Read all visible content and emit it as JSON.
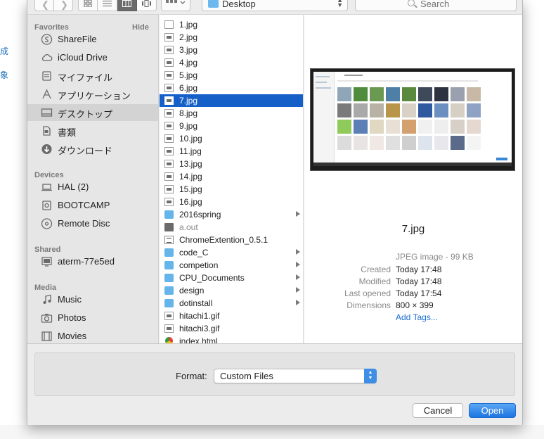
{
  "background": {
    "left_chars": [
      "成",
      "象"
    ]
  },
  "toolbar": {
    "location": "Desktop",
    "search_placeholder": "Search"
  },
  "sidebar": {
    "hide_label": "Hide",
    "sections": [
      {
        "title": "Favorites",
        "items": [
          {
            "label": "ShareFile",
            "icon": "sharefile-icon"
          },
          {
            "label": "iCloud Drive",
            "icon": "cloud-icon"
          },
          {
            "label": "マイファイル",
            "icon": "all-my-files-icon"
          },
          {
            "label": "アプリケーション",
            "icon": "applications-icon"
          },
          {
            "label": "デスクトップ",
            "icon": "desktop-icon",
            "selected": true
          },
          {
            "label": "書類",
            "icon": "documents-icon"
          },
          {
            "label": "ダウンロード",
            "icon": "downloads-icon"
          }
        ]
      },
      {
        "title": "Devices",
        "items": [
          {
            "label": "HAL (2)",
            "icon": "laptop-icon"
          },
          {
            "label": "BOOTCAMP",
            "icon": "drive-icon"
          },
          {
            "label": "Remote Disc",
            "icon": "disc-icon"
          }
        ]
      },
      {
        "title": "Shared",
        "items": [
          {
            "label": "aterm-77e5ed",
            "icon": "monitor-icon"
          }
        ]
      },
      {
        "title": "Media",
        "items": [
          {
            "label": "Music",
            "icon": "music-icon"
          },
          {
            "label": "Photos",
            "icon": "camera-icon"
          },
          {
            "label": "Movies",
            "icon": "film-icon"
          }
        ]
      }
    ]
  },
  "files": [
    {
      "name": "1.jpg",
      "kind": "img-blank"
    },
    {
      "name": "2.jpg",
      "kind": "img"
    },
    {
      "name": "3.jpg",
      "kind": "img"
    },
    {
      "name": "4.jpg",
      "kind": "img"
    },
    {
      "name": "5.jpg",
      "kind": "img"
    },
    {
      "name": "6.jpg",
      "kind": "img"
    },
    {
      "name": "7.jpg",
      "kind": "img",
      "selected": true
    },
    {
      "name": "8.jpg",
      "kind": "img"
    },
    {
      "name": "9.jpg",
      "kind": "img"
    },
    {
      "name": "10.jpg",
      "kind": "img"
    },
    {
      "name": "11.jpg",
      "kind": "img"
    },
    {
      "name": "13.jpg",
      "kind": "img"
    },
    {
      "name": "14.jpg",
      "kind": "img"
    },
    {
      "name": "15.jpg",
      "kind": "img"
    },
    {
      "name": "16.jpg",
      "kind": "img"
    },
    {
      "name": "2016spring",
      "kind": "folder",
      "arrow": true
    },
    {
      "name": "a.out",
      "kind": "exec",
      "dim": true
    },
    {
      "name": "ChromeExtention_0.5.1",
      "kind": "doc"
    },
    {
      "name": "code_C",
      "kind": "folder",
      "arrow": true
    },
    {
      "name": "competion",
      "kind": "folder",
      "arrow": true
    },
    {
      "name": "CPU_Documents",
      "kind": "folder",
      "arrow": true
    },
    {
      "name": "design",
      "kind": "folder",
      "arrow": true
    },
    {
      "name": "dotinstall",
      "kind": "folder",
      "arrow": true
    },
    {
      "name": "hitachi1.gif",
      "kind": "img"
    },
    {
      "name": "hitachi3.gif",
      "kind": "img"
    },
    {
      "name": "index.html",
      "kind": "html"
    }
  ],
  "preview": {
    "name": "7.jpg",
    "kind": "JPEG image - 99 KB",
    "meta": [
      {
        "label": "Created",
        "value": "Today 17:48"
      },
      {
        "label": "Modified",
        "value": "Today 17:48"
      },
      {
        "label": "Last opened",
        "value": "Today 17:54"
      },
      {
        "label": "Dimensions",
        "value": "800 × 399"
      }
    ],
    "add_tags": "Add Tags...",
    "thumbnail_colors": [
      "#8fa6b8",
      "#4f8c3b",
      "#6a9a52",
      "#4e7fa6",
      "#5a8a3e",
      "#3e4a5a",
      "#2d3140",
      "#9aa0ae",
      "#c7b9a6",
      "#7a7a7a",
      "#a9a9a9",
      "#b8b2a4",
      "#b89548",
      "#d8d2c6",
      "#2f5aa0",
      "#6a8fc0",
      "#d6cfc4",
      "#8ea2c4",
      "#8fca5a",
      "#5c7fb6",
      "#e0d8c0",
      "#e8e0d4",
      "#d4a070",
      "#f0f0f0",
      "#eeeeee",
      "#d6d0c8",
      "#e4d8d0",
      "#dcdcdc",
      "#e8e4e4",
      "#f0e8e4",
      "#e0e0e0",
      "#cfcfcf",
      "#dde4ee",
      "#e8e8ec",
      "#5a6a8a",
      "#f4f4f4"
    ]
  },
  "bottom": {
    "format_label": "Format:",
    "format_value": "Custom Files",
    "cancel": "Cancel",
    "open": "Open"
  },
  "colors": {
    "selection": "#1560c8",
    "accent": "#1d75e2",
    "folder": "#65b4ea"
  }
}
